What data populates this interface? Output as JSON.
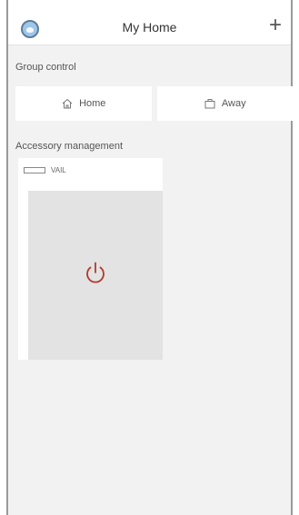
{
  "header": {
    "title": "My Home",
    "add_label": "+",
    "avatar_icon": "user-avatar-icon"
  },
  "group_control": {
    "label": "Group control",
    "buttons": [
      {
        "label": "Home",
        "icon": "home-icon"
      },
      {
        "label": "Away",
        "icon": "suitcase-icon"
      }
    ]
  },
  "accessory_management": {
    "label": "Accessory management",
    "accessories": [
      {
        "name": "VAIL",
        "icon": "device-icon",
        "power_icon": "power-icon",
        "power_color": "#b03a2e"
      }
    ]
  }
}
